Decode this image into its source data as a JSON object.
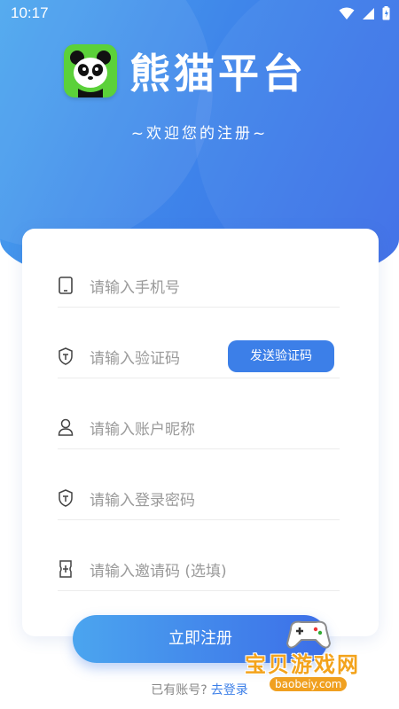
{
  "status_bar": {
    "time": "10:17"
  },
  "header": {
    "app_title": "熊猫平台",
    "subtitle": "~欢迎您的注册~"
  },
  "form": {
    "fields": [
      {
        "placeholder": "请输入手机号",
        "icon": "phone-icon"
      },
      {
        "placeholder": "请输入验证码",
        "icon": "shield-icon"
      },
      {
        "placeholder": "请输入账户昵称",
        "icon": "user-icon"
      },
      {
        "placeholder": "请输入登录密码",
        "icon": "shield-icon"
      },
      {
        "placeholder": "请输入邀请码 (选填)",
        "icon": "ticket-icon"
      }
    ],
    "send_code_label": "发送验证码",
    "register_label": "立即注册"
  },
  "footer": {
    "have_account": "已有账号?",
    "login_link": "去登录"
  },
  "watermark": {
    "text": "宝贝游戏网",
    "url": "baobeiy.com"
  },
  "colors": {
    "accent": "#3c7fe8",
    "logo_green": "#5bd13a"
  }
}
